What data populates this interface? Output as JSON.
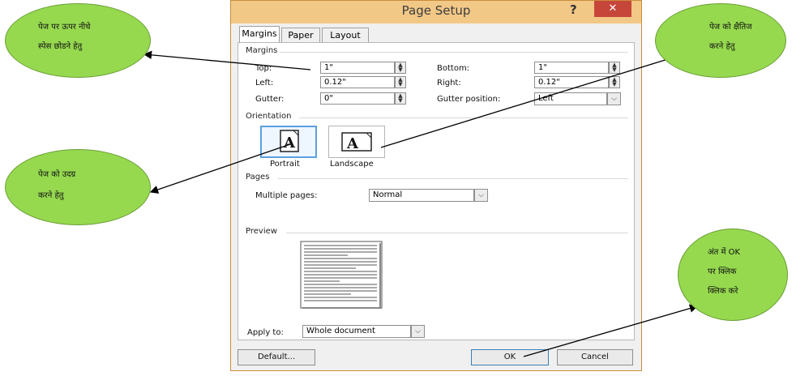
{
  "dialog": {
    "title": "Page Setup",
    "help": "?",
    "close": "✕",
    "tabs": [
      "Margins",
      "Paper",
      "Layout"
    ],
    "margins": {
      "section": "Margins",
      "top_label": "Top:",
      "top_value": "1\"",
      "bottom_label": "Bottom:",
      "bottom_value": "1\"",
      "left_label": "Left:",
      "left_value": "0.12\"",
      "right_label": "Right:",
      "right_value": "0.12\"",
      "gutter_label": "Gutter:",
      "gutter_value": "0\"",
      "gutter_pos_label": "Gutter position:",
      "gutter_pos_value": "Left"
    },
    "orientation": {
      "section": "Orientation",
      "portrait": "Portrait",
      "landscape": "Landscape",
      "glyph": "A"
    },
    "pages": {
      "section": "Pages",
      "multiple_label": "Multiple pages:",
      "multiple_value": "Normal"
    },
    "preview": {
      "section": "Preview"
    },
    "apply": {
      "label": "Apply to:",
      "value": "Whole document"
    },
    "buttons": {
      "default": "Default...",
      "ok": "OK",
      "cancel": "Cancel"
    }
  },
  "callouts": {
    "top_left": [
      "पेज पर ऊपर नीचे",
      "स्पेस छोडने हेतु"
    ],
    "top_right": [
      "पेज को क्षैतिज",
      "करने हेतु"
    ],
    "mid_left": [
      "पेज को उदग्र",
      "करने हेतु"
    ],
    "bottom_right": [
      "अंत में OK",
      "पर क्लिक",
      "क्लिक करे"
    ]
  },
  "colors": {
    "bubble": "#96d94f",
    "titlebar": "#f2c887",
    "close": "#c7463a",
    "selected_border": "#5aa0e0"
  }
}
